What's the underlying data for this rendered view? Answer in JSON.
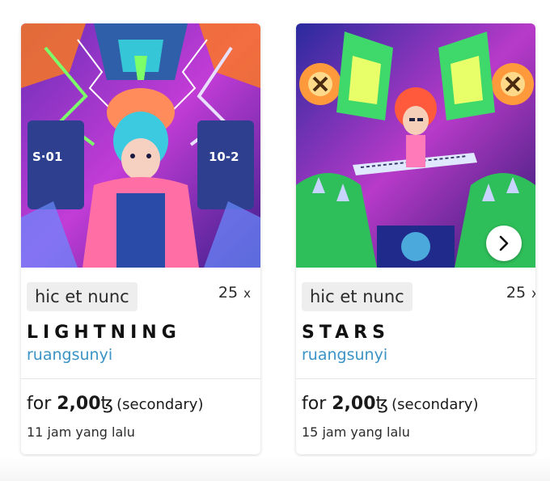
{
  "cards": [
    {
      "platform": "hic et nunc",
      "editions": "25",
      "editions_suffix": "x",
      "title": "LIGHTNING",
      "artist": "ruangsunyi",
      "price_prefix": "for",
      "price_amount": "2,00",
      "currency_symbol": "ꜩ",
      "price_qualifier": "(secondary)",
      "time": "11 jam yang lalu",
      "artwork_text_left": "S·01",
      "artwork_text_right": "10-2"
    },
    {
      "platform": "hic et nunc",
      "editions": "25",
      "editions_suffix": "x",
      "title": "STARS",
      "artist": "ruangsunyi",
      "price_prefix": "for",
      "price_amount": "2,00",
      "currency_symbol": "ꜩ",
      "price_qualifier": "(secondary)",
      "time": "15 jam yang lalu",
      "next_icon": "chevron-right-icon"
    }
  ],
  "colors": {
    "artist_link": "#3b93c5",
    "platform_chip_bg": "#eeeeee"
  }
}
